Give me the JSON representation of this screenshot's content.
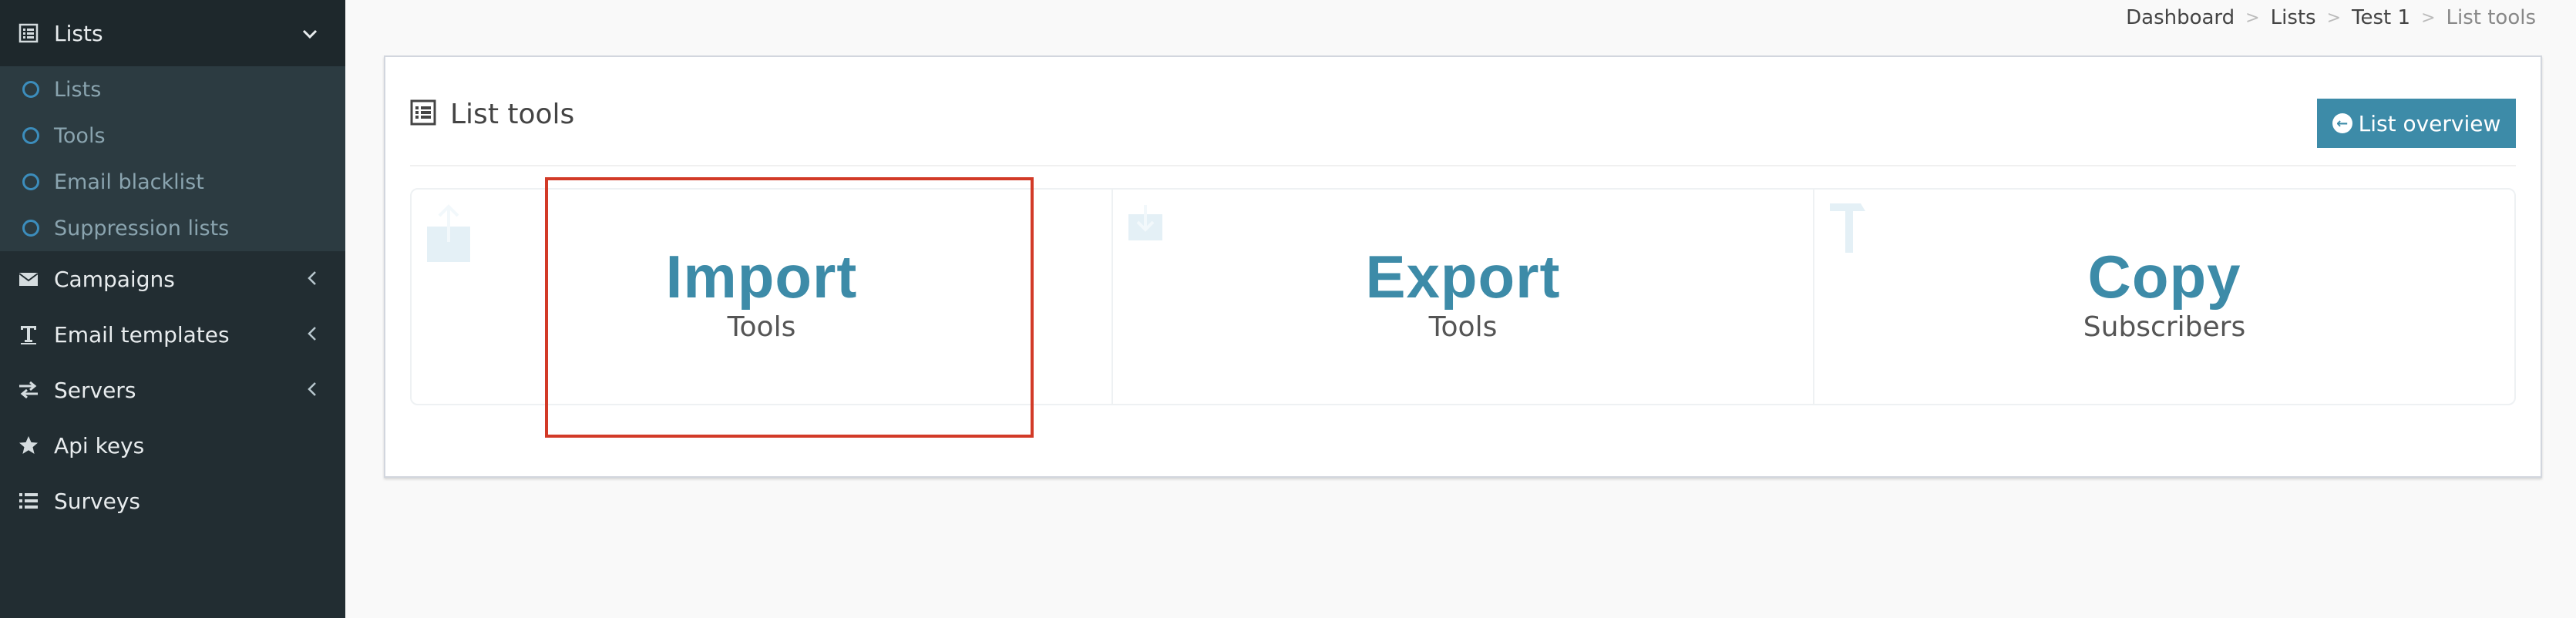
{
  "sidebar": {
    "active": {
      "label": "Lists",
      "icon": "list-icon"
    },
    "submenu": [
      {
        "label": "Lists"
      },
      {
        "label": "Tools"
      },
      {
        "label": "Email blacklist"
      },
      {
        "label": "Suppression lists"
      }
    ],
    "items": [
      {
        "label": "Campaigns",
        "icon": "envelope-icon"
      },
      {
        "label": "Email templates",
        "icon": "text-icon"
      },
      {
        "label": "Servers",
        "icon": "exchange-icon"
      },
      {
        "label": "Api keys",
        "icon": "star-icon"
      },
      {
        "label": "Surveys",
        "icon": "list-ul-icon"
      }
    ]
  },
  "breadcrumb": {
    "items": [
      "Dashboard",
      "Lists",
      "Test 1"
    ],
    "current": "List tools"
  },
  "box": {
    "title": "List tools",
    "overview_button": "List overview"
  },
  "tools": [
    {
      "title": "Import",
      "subtitle": "Tools"
    },
    {
      "title": "Export",
      "subtitle": "Tools"
    },
    {
      "title": "Copy",
      "subtitle": "Subscribers"
    }
  ],
  "colors": {
    "sidebar_bg": "#222d32",
    "accent": "#3d8ba8",
    "highlight": "#d23a27"
  }
}
